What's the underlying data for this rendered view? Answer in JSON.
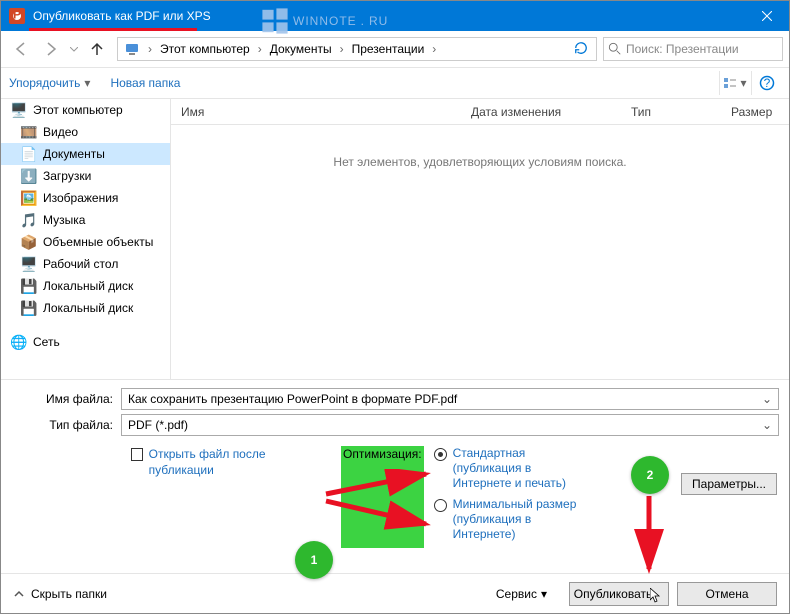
{
  "window": {
    "title": "Опубликовать как PDF или XPS"
  },
  "watermark": {
    "text1": "WINNOTE",
    "text2": "RU"
  },
  "breadcrumb": {
    "root": "Этот компьютер",
    "folder1": "Документы",
    "folder2": "Презентации"
  },
  "search": {
    "placeholder": "Поиск: Презентации"
  },
  "toolbar": {
    "organize": "Упорядочить",
    "new_folder": "Новая папка"
  },
  "tree": {
    "this_pc": "Этот компьютер",
    "video": "Видео",
    "documents": "Документы",
    "downloads": "Загрузки",
    "images": "Изображения",
    "music": "Музыка",
    "volumes": "Объемные объекты",
    "desktop": "Рабочий стол",
    "local_c": "Локальный диск",
    "local_d": "Локальный диск",
    "network": "Сеть"
  },
  "columns": {
    "name": "Имя",
    "date": "Дата изменения",
    "type": "Тип",
    "size": "Размер"
  },
  "empty": "Нет элементов, удовлетворяющих условиям поиска.",
  "fields": {
    "filename_label": "Имя файла:",
    "filename_value": "Как сохранить презентацию PowerPoint в формате PDF.pdf",
    "filetype_label": "Тип файла:",
    "filetype_value": "PDF (*.pdf)"
  },
  "options": {
    "open_after": "Открыть файл после публикации",
    "optimize_label": "Оптимизация:",
    "radio_standard": "Стандартная (публикация в Интернете и печать)",
    "radio_minimal": "Минимальный размер (публикация в Интернете)",
    "params_btn": "Параметры..."
  },
  "footer": {
    "hide_folders": "Скрыть папки",
    "service": "Сервис",
    "publish": "Опубликовать",
    "cancel": "Отмена"
  },
  "annotations": {
    "one": "1",
    "two": "2"
  }
}
